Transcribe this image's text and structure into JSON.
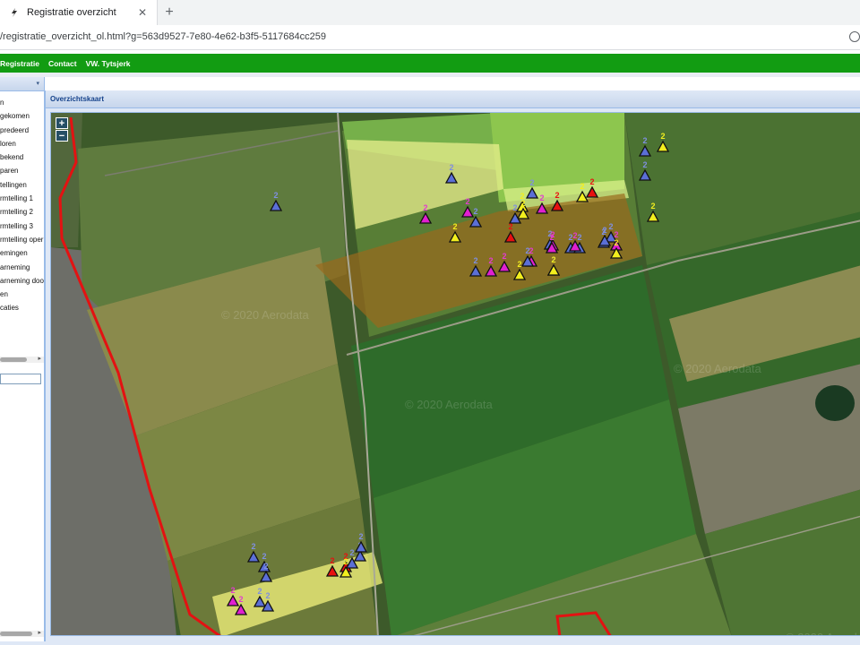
{
  "browser": {
    "tab_title": "Registratie overzicht",
    "tab_close": "✕",
    "new_tab": "+",
    "url": "/registratie_overzicht_ol.html?g=563d9527-7e80-4e62-b3f5-5117684cc259"
  },
  "nav": {
    "items": [
      "Registratie",
      "Contact",
      "VW. Tytsjerk"
    ]
  },
  "left_panel": {
    "caret": "▾",
    "layers": [
      "n",
      "gekomen",
      "predeerd",
      "loren",
      "bekend",
      "paren",
      "tellingen",
      "rmtelling 1",
      "rmtelling 2",
      "rmtelling 3",
      "rmtelling oper",
      "emingen",
      "arneming",
      "arneming doo",
      "en",
      "caties"
    ]
  },
  "map_panel": {
    "title": "Overzichtskaart",
    "zoom_in": "+",
    "zoom_out": "−",
    "watermarks": [
      "© 2020 Aerodata",
      "© 2020 Aerodata",
      "© 2020 Aerodata",
      "© 2020 Aerodata"
    ],
    "marker_colors": {
      "blue": "#5b6fd6",
      "magenta": "#e020d0",
      "yellow": "#f2ee1e",
      "red": "#e81010"
    },
    "label_colors": {
      "blue": "#7f8fe0",
      "magenta": "#e23ccf",
      "yellow": "#f2ee1e",
      "red": "#e81010"
    },
    "markers": [
      {
        "color": "blue",
        "label": "2"
      },
      {
        "color": "blue",
        "label": "2"
      },
      {
        "color": "yellow",
        "label": "2"
      },
      {
        "color": "blue",
        "label": "2"
      },
      {
        "color": "magenta",
        "label": "2"
      },
      {
        "color": "magenta",
        "label": "2"
      },
      {
        "color": "yellow",
        "label": "2"
      },
      {
        "color": "blue",
        "label": "2"
      },
      {
        "color": "yellow",
        "label": "2"
      },
      {
        "color": "blue",
        "label": "2"
      },
      {
        "color": "yellow",
        "label": "2"
      },
      {
        "color": "blue",
        "label": "2"
      },
      {
        "color": "magenta",
        "label": "2"
      },
      {
        "color": "red",
        "label": "2"
      },
      {
        "color": "yellow",
        "label": "2"
      },
      {
        "color": "red",
        "label": "2"
      },
      {
        "color": "yellow",
        "label": "2"
      },
      {
        "color": "red",
        "label": "2"
      },
      {
        "color": "blue",
        "label": "2"
      },
      {
        "color": "magenta",
        "label": "2"
      },
      {
        "color": "magenta",
        "label": "2"
      },
      {
        "color": "blue",
        "label": "2"
      },
      {
        "color": "magenta",
        "label": "2"
      },
      {
        "color": "magenta",
        "label": "2"
      },
      {
        "color": "blue",
        "label": "2"
      },
      {
        "color": "blue",
        "label": "2"
      },
      {
        "color": "magenta",
        "label": "2"
      },
      {
        "color": "blue",
        "label": "2"
      },
      {
        "color": "blue",
        "label": "2"
      },
      {
        "color": "blue",
        "label": "2"
      },
      {
        "color": "magenta",
        "label": "2"
      },
      {
        "color": "blue",
        "label": "2"
      },
      {
        "color": "magenta",
        "label": "2"
      },
      {
        "color": "blue",
        "label": "2"
      },
      {
        "color": "yellow",
        "label": "2"
      },
      {
        "color": "yellow",
        "label": "2"
      },
      {
        "color": "blue",
        "label": "2"
      },
      {
        "color": "yellow",
        "label": "2"
      },
      {
        "color": "blue",
        "label": "2"
      },
      {
        "color": "blue",
        "label": "2"
      },
      {
        "color": "blue",
        "label": "2"
      },
      {
        "color": "red",
        "label": "2"
      },
      {
        "color": "red",
        "label": "2"
      },
      {
        "color": "blue",
        "label": "2"
      },
      {
        "color": "blue",
        "label": "2"
      },
      {
        "color": "blue",
        "label": "2"
      },
      {
        "color": "yellow",
        "label": "2"
      },
      {
        "color": "magenta",
        "label": "2"
      },
      {
        "color": "magenta",
        "label": "2"
      },
      {
        "color": "blue",
        "label": "2"
      },
      {
        "color": "blue",
        "label": "2"
      }
    ]
  }
}
